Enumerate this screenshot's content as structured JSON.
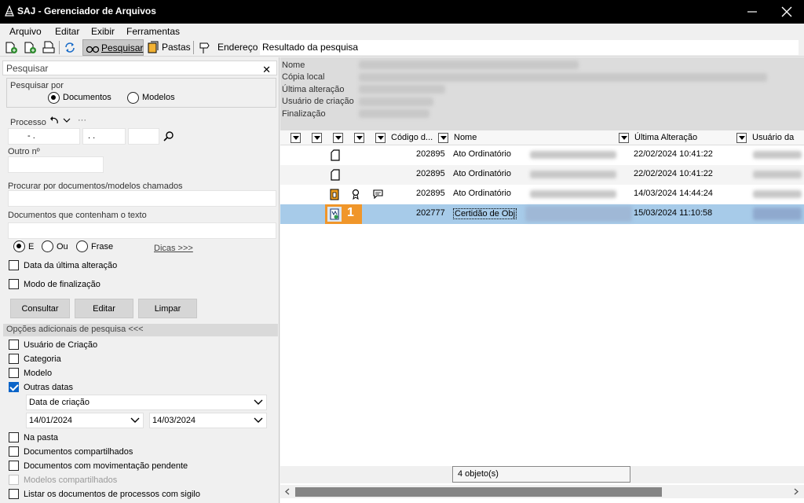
{
  "window": {
    "title": "SAJ - Gerenciador de Arquivos"
  },
  "menu": [
    "Arquivo",
    "Editar",
    "Exibir",
    "Ferramentas"
  ],
  "toolbar": {
    "search_label": "Pesquisar",
    "folders_label": "Pastas",
    "address_label": "Endereço",
    "address_value": "Resultado da pesquisa"
  },
  "search_panel": {
    "header": "Pesquisar",
    "search_by_label": "Pesquisar por",
    "search_by_options": [
      "Documentos",
      "Modelos"
    ],
    "process_label": "Processo",
    "process_more": "···",
    "process_parts": [
      "-  .",
      ".  .",
      ""
    ],
    "other_number_label": "Outro nº",
    "called_docs_label": "Procurar por documentos/modelos chamados",
    "contains_text_label": "Documentos que contenham o texto",
    "logic_options": [
      "E",
      "Ou",
      "Frase"
    ],
    "tips_link": "Dicas >>>",
    "last_change_date_label": "Data da última alteração",
    "finalization_mode_label": "Modo de finalização",
    "buttons": {
      "consult": "Consultar",
      "edit": "Editar",
      "clear": "Limpar"
    },
    "additional_options_header": "Opções adicionais de pesquisa <<<",
    "options": [
      {
        "label": "Usuário de Criação",
        "checked": false
      },
      {
        "label": "Categoria",
        "checked": false
      },
      {
        "label": "Modelo",
        "checked": false
      },
      {
        "label": "Outras datas",
        "checked": true
      }
    ],
    "date_type": "Data de criação",
    "date_from": "14/01/2024",
    "date_to": "14/03/2024",
    "bottom_options": [
      {
        "label": "Na pasta",
        "checked": false
      },
      {
        "label": "Documentos compartilhados",
        "checked": false
      },
      {
        "label": "Documentos com movimentação pendente",
        "checked": false
      },
      {
        "label": "Modelos compartilhados",
        "checked": false,
        "disabled": true
      },
      {
        "label": "Listar os documentos de processos com sigilo",
        "checked": false
      }
    ]
  },
  "details": {
    "labels": [
      "Nome",
      "Cópia local",
      "Última alteração",
      "Usuário de criação",
      "Finalização"
    ]
  },
  "grid": {
    "columns": [
      "Código d...",
      "Nome",
      "Última Alteração",
      "Usuário da"
    ],
    "rows": [
      {
        "code": "202895",
        "name": "Ato Ordinatório",
        "date": "22/02/2024 10:41:22"
      },
      {
        "code": "202895",
        "name": "Ato Ordinatório",
        "date": "22/02/2024 10:41:22"
      },
      {
        "code": "202895",
        "name": "Ato Ordinatório",
        "date": "14/03/2024 14:44:24"
      },
      {
        "code": "202777",
        "name": "Certidão de Obj",
        "date": "15/03/2024 11:10:58"
      }
    ],
    "annotation_badge": "1"
  },
  "status": {
    "count_text": "4 objeto(s)"
  },
  "colors": {
    "accent": "#0a64c8",
    "selection": "#a7cbe9",
    "badge": "#f0962a"
  }
}
